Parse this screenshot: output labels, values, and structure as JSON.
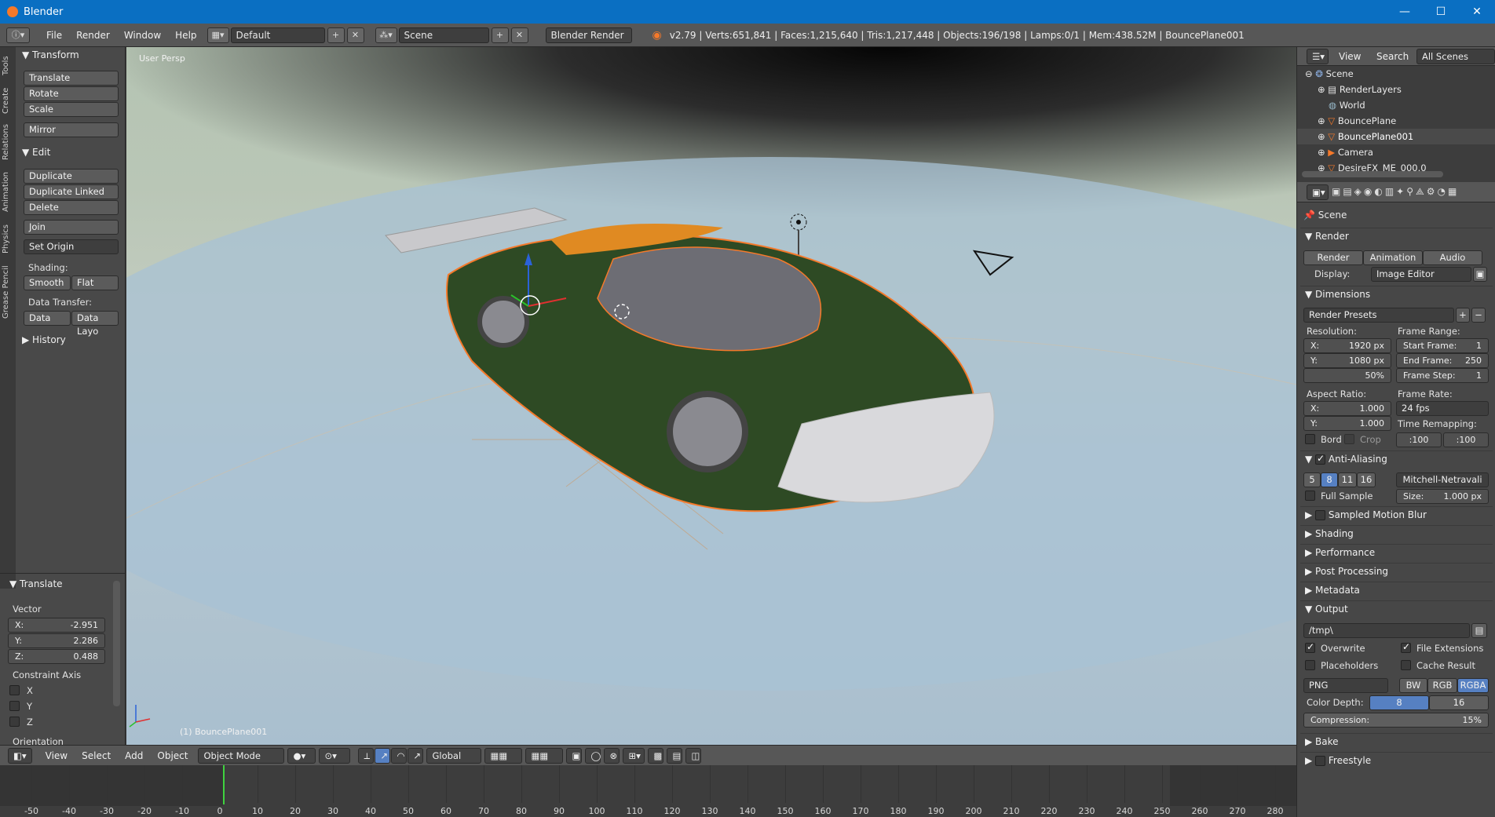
{
  "titlebar": {
    "title": "Blender",
    "minimize": "—",
    "maximize": "☐",
    "close": "✕"
  },
  "infobar": {
    "menus": [
      "File",
      "Render",
      "Window",
      "Help"
    ],
    "layout": "Default",
    "scene": "Scene",
    "engine": "Blender Render",
    "stats": "v2.79 | Verts:651,841 | Faces:1,215,640 | Tris:1,217,448 | Objects:196/198 | Lamps:0/1 | Mem:438.52M | BouncePlane001"
  },
  "tools": {
    "tabs": [
      "Tools",
      "Create",
      "Relations",
      "Animation",
      "Physics",
      "Grease Pencil"
    ],
    "transform_title": "Transform",
    "translate": "Translate",
    "rotate": "Rotate",
    "scale": "Scale",
    "mirror": "Mirror",
    "edit_title": "Edit",
    "duplicate": "Duplicate",
    "duplicate_linked": "Duplicate Linked",
    "delete": "Delete",
    "join": "Join",
    "set_origin": "Set Origin",
    "shading_label": "Shading:",
    "smooth": "Smooth",
    "flat": "Flat",
    "data_transfer_label": "Data Transfer:",
    "data": "Data",
    "data_layo": "Data Layo",
    "history": "History"
  },
  "operator": {
    "title": "Translate",
    "vector_label": "Vector",
    "x_label": "X:",
    "x": "-2.951",
    "y_label": "Y:",
    "y": "2.286",
    "z_label": "Z:",
    "z": "0.488",
    "constraint_label": "Constraint Axis",
    "cx": "X",
    "cy": "Y",
    "cz": "Z",
    "orientation": "Orientation"
  },
  "viewport": {
    "view_name": "User Persp",
    "active_object": "(1) BouncePlane001"
  },
  "view3d_header": {
    "view": "View",
    "select": "Select",
    "add": "Add",
    "object": "Object",
    "mode": "Object Mode",
    "orientation": "Global"
  },
  "timeline": {
    "ticks": [
      "-50",
      "-40",
      "-30",
      "-20",
      "-10",
      "0",
      "10",
      "20",
      "30",
      "40",
      "50",
      "60",
      "70",
      "80",
      "90",
      "100",
      "110",
      "120",
      "130",
      "140",
      "150",
      "160",
      "170",
      "180",
      "190",
      "200",
      "210",
      "220",
      "230",
      "240",
      "250",
      "260",
      "270",
      "280"
    ],
    "current_frame": "0"
  },
  "outliner": {
    "view": "View",
    "search": "Search",
    "filter": "All Scenes",
    "items": [
      "Scene",
      "RenderLayers",
      "World",
      "BouncePlane",
      "BouncePlane001",
      "Camera",
      "DesireFX_ME_000.0"
    ]
  },
  "properties": {
    "context": "Scene",
    "render_title": "Render",
    "render_btn": "Render",
    "animation_btn": "Animation",
    "audio_btn": "Audio",
    "display_label": "Display:",
    "display_value": "Image Editor",
    "dimensions_title": "Dimensions",
    "presets": "Render Presets",
    "resolution_label": "Resolution:",
    "res_x_label": "X:",
    "res_x": "1920 px",
    "res_y_label": "Y:",
    "res_y": "1080 px",
    "res_pct": "50%",
    "frame_range_label": "Frame Range:",
    "start_label": "Start Frame:",
    "start": "1",
    "end_label": "End Frame:",
    "end": "250",
    "step_label": "Frame Step:",
    "step": "1",
    "aspect_label": "Aspect Ratio:",
    "asp_x_label": "X:",
    "asp_x": "1.000",
    "asp_y_label": "Y:",
    "asp_y": "1.000",
    "frame_rate_label": "Frame Rate:",
    "fps": "24 fps",
    "remap_label": "Time Remapping:",
    "remap_old": ":100",
    "remap_new": ":100",
    "bord": "Bord",
    "crop": "Crop",
    "aa_title": "Anti-Aliasing",
    "aa5": "5",
    "aa8": "8",
    "aa11": "11",
    "aa16": "16",
    "aa_filter": "Mitchell-Netravali",
    "full_sample": "Full Sample",
    "size_label": "Size:",
    "size": "1.000 px",
    "motion_blur": "Sampled Motion Blur",
    "shading": "Shading",
    "performance": "Performance",
    "post_processing": "Post Processing",
    "metadata": "Metadata",
    "output_title": "Output",
    "output_path": "/tmp\\",
    "overwrite": "Overwrite",
    "file_ext": "File Extensions",
    "placeholders": "Placeholders",
    "cache_result": "Cache Result",
    "format": "PNG",
    "bw": "BW",
    "rgb": "RGB",
    "rgba": "RGBA",
    "color_depth_label": "Color Depth:",
    "depth8": "8",
    "depth16": "16",
    "compression_label": "Compression:",
    "compression": "15%",
    "bake": "Bake",
    "freestyle": "Freestyle"
  },
  "colors": {
    "accent": "#5680c2",
    "car_body": "#2e4a24",
    "highlight": "#f5792a"
  }
}
